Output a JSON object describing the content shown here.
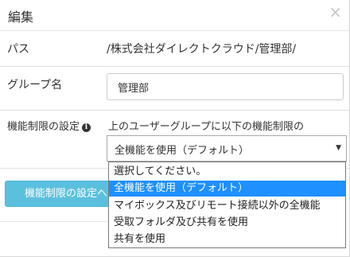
{
  "header": {
    "title": "編集",
    "close": "×"
  },
  "path": {
    "label": "パス",
    "value": "/株式会社ダイレクトクラウド/管理部/"
  },
  "group": {
    "label": "グループ名",
    "value": "管理部"
  },
  "restriction": {
    "label": "機能制限の設定",
    "info_icon": "i",
    "description": "上のユーザーグループに以下の機能制限の",
    "selected": "全機能を使用（デフォルト）",
    "options": [
      "選択してください。",
      "全機能を使用（デフォルト）",
      "マイボックス及びリモート接続以外の全機能",
      "受取フォルダ及び共有を使用",
      "共有を使用"
    ],
    "highlighted_index": 1
  },
  "actions": {
    "restriction_button": "機能制限の設定へ"
  },
  "colors": {
    "button": "#5bc0de",
    "highlight": "#1e90ff"
  }
}
